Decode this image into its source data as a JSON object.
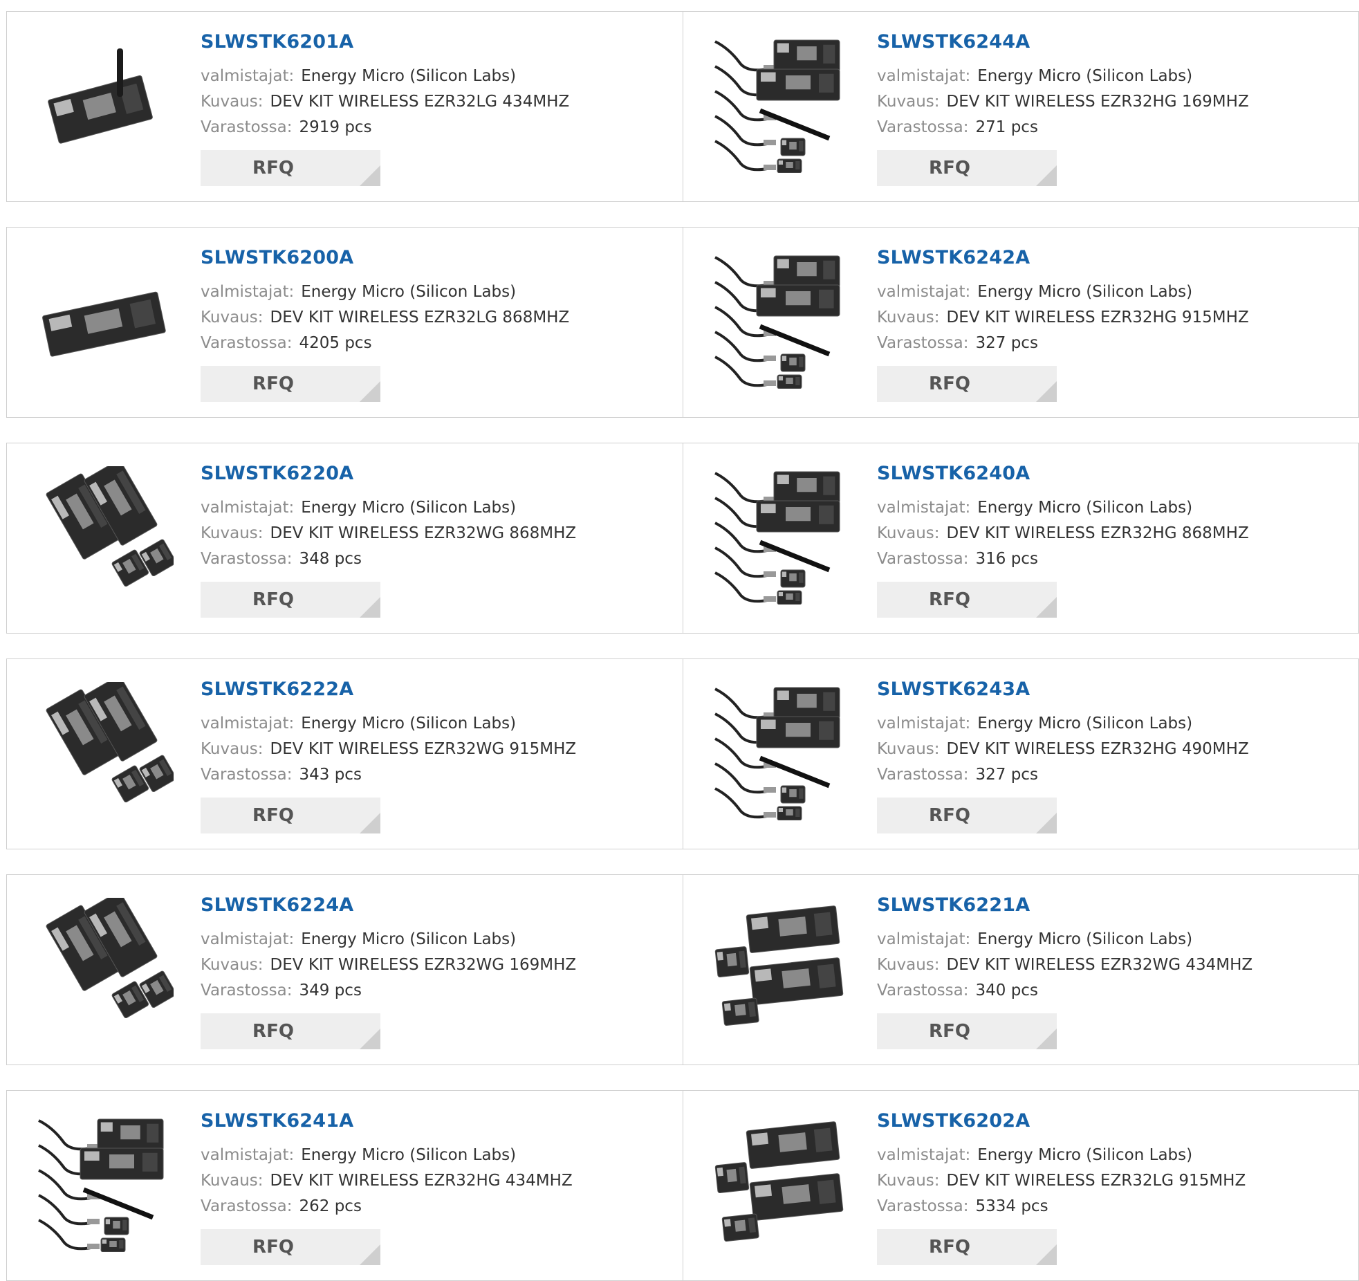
{
  "labels": {
    "manufacturer": "valmistajat:",
    "description": "Kuvaus:",
    "stock": "Varastossa:",
    "rfq": "RFQ"
  },
  "products": [
    {
      "part": "SLWSTK6201A",
      "manufacturer": "Energy Micro (Silicon Labs)",
      "description": "DEV KIT WIRELESS EZR32LG 434MHZ",
      "stock": "2919 pcs",
      "image": "board-antenna"
    },
    {
      "part": "SLWSTK6244A",
      "manufacturer": "Energy Micro (Silicon Labs)",
      "description": "DEV KIT WIRELESS EZR32HG 169MHZ",
      "stock": "271 pcs",
      "image": "kit-cables"
    },
    {
      "part": "SLWSTK6200A",
      "manufacturer": "Energy Micro (Silicon Labs)",
      "description": "DEV KIT WIRELESS EZR32LG 868MHZ",
      "stock": "4205 pcs",
      "image": "board-single"
    },
    {
      "part": "SLWSTK6242A",
      "manufacturer": "Energy Micro (Silicon Labs)",
      "description": "DEV KIT WIRELESS EZR32HG 915MHZ",
      "stock": "327 pcs",
      "image": "kit-cables"
    },
    {
      "part": "SLWSTK6220A",
      "manufacturer": "Energy Micro (Silicon Labs)",
      "description": "DEV KIT WIRELESS EZR32WG 868MHZ",
      "stock": "348 pcs",
      "image": "kit-boards"
    },
    {
      "part": "SLWSTK6240A",
      "manufacturer": "Energy Micro (Silicon Labs)",
      "description": "DEV KIT WIRELESS EZR32HG 868MHZ",
      "stock": "316 pcs",
      "image": "kit-cables"
    },
    {
      "part": "SLWSTK6222A",
      "manufacturer": "Energy Micro (Silicon Labs)",
      "description": "DEV KIT WIRELESS EZR32WG 915MHZ",
      "stock": "343 pcs",
      "image": "kit-boards"
    },
    {
      "part": "SLWSTK6243A",
      "manufacturer": "Energy Micro (Silicon Labs)",
      "description": "DEV KIT WIRELESS EZR32HG 490MHZ",
      "stock": "327 pcs",
      "image": "kit-cables"
    },
    {
      "part": "SLWSTK6224A",
      "manufacturer": "Energy Micro (Silicon Labs)",
      "description": "DEV KIT WIRELESS EZR32WG 169MHZ",
      "stock": "349 pcs",
      "image": "kit-boards"
    },
    {
      "part": "SLWSTK6221A",
      "manufacturer": "Energy Micro (Silicon Labs)",
      "description": "DEV KIT WIRELESS EZR32WG 434MHZ",
      "stock": "340 pcs",
      "image": "kit-two-boards"
    },
    {
      "part": "SLWSTK6241A",
      "manufacturer": "Energy Micro (Silicon Labs)",
      "description": "DEV KIT WIRELESS EZR32HG 434MHZ",
      "stock": "262 pcs",
      "image": "kit-cables"
    },
    {
      "part": "SLWSTK6202A",
      "manufacturer": "Energy Micro (Silicon Labs)",
      "description": "DEV KIT WIRELESS EZR32LG 915MHZ",
      "stock": "5334 pcs",
      "image": "kit-two-boards"
    }
  ]
}
